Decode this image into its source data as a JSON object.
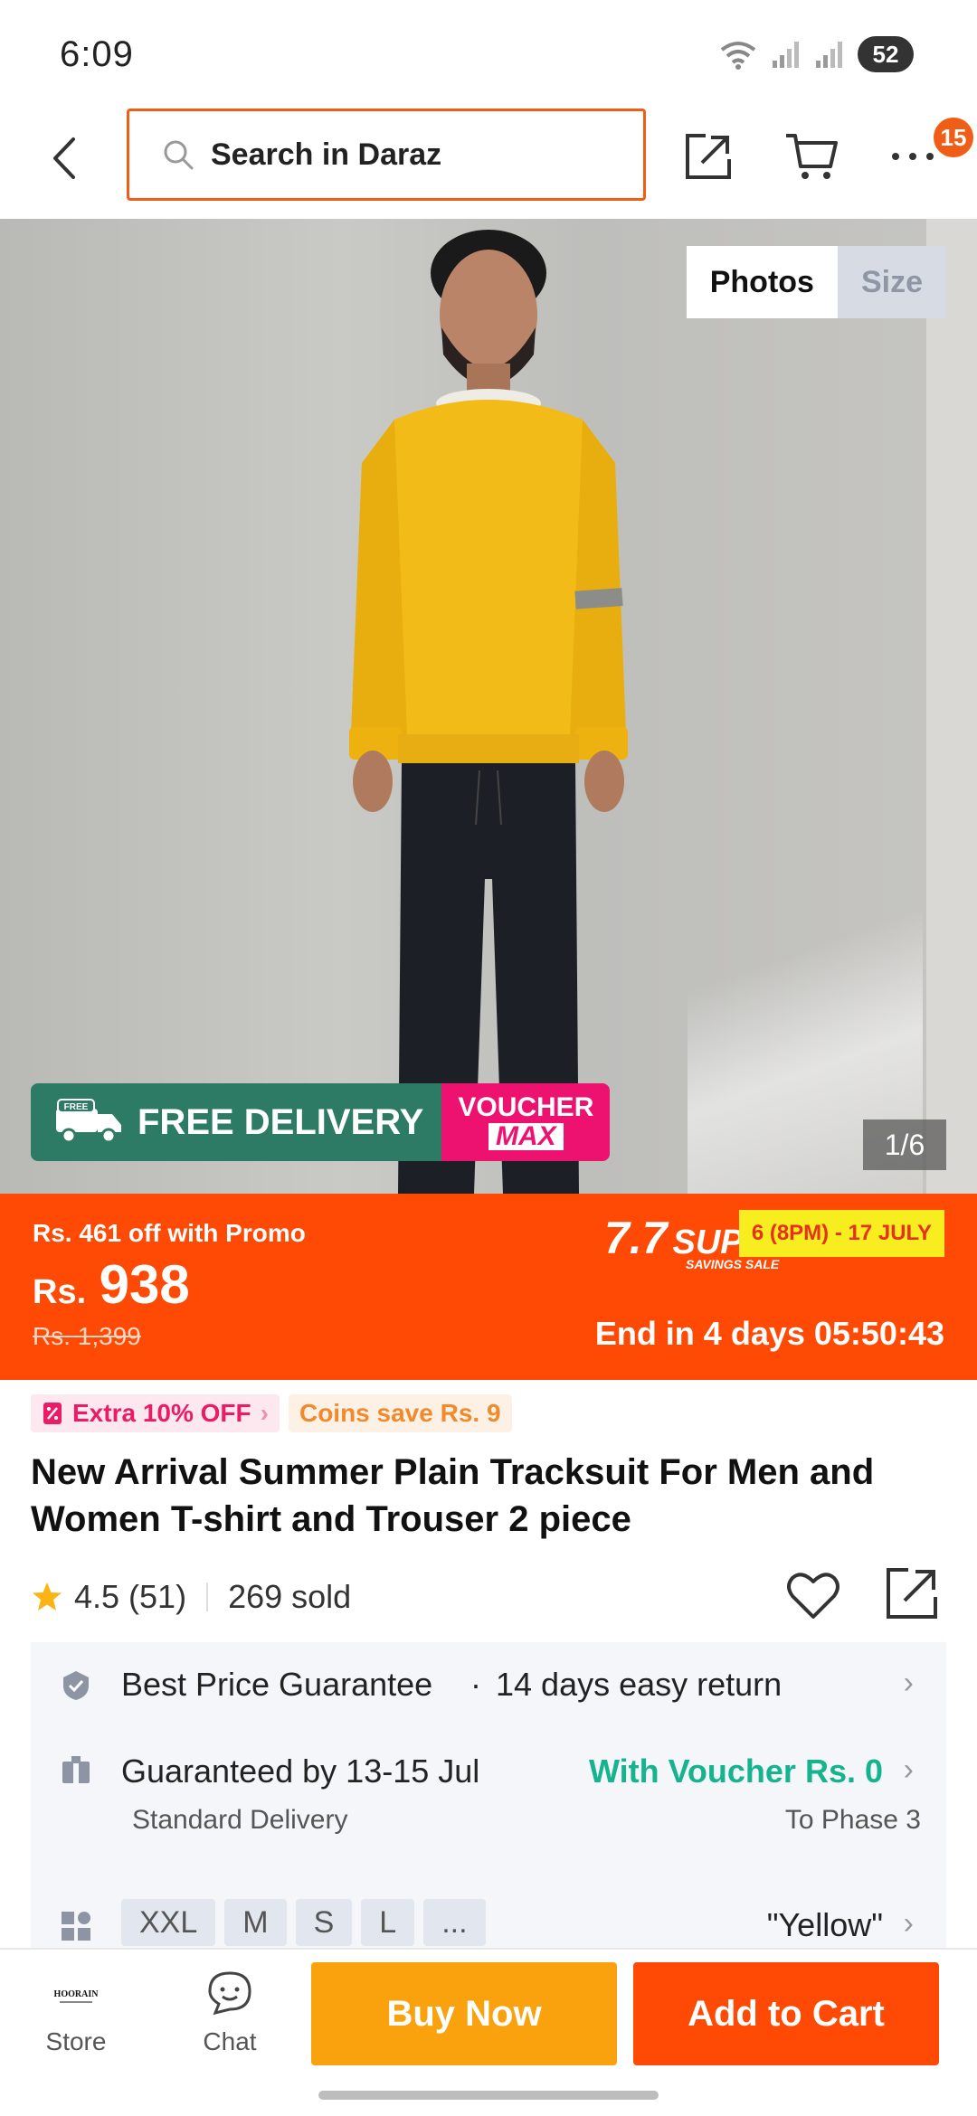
{
  "status_bar": {
    "time": "6:09",
    "battery": "52"
  },
  "header": {
    "search_placeholder": "Search in Daraz",
    "cart_badge": "15"
  },
  "gallery": {
    "tabs": [
      "Photos",
      "Size"
    ],
    "counter": "1/6",
    "free_delivery": {
      "free_tag": "FREE",
      "label": "FREE DELIVERY",
      "voucher_top": "VOUCHER",
      "voucher_bottom": "MAX"
    }
  },
  "price": {
    "promo_text": "Rs. 461 off with Promo",
    "currency": "Rs.",
    "current": "938",
    "original": "Rs. 1,399",
    "sale_logo_big": "7.7",
    "sale_logo_super": "SUPER",
    "sale_logo_sub": "SAVINGS SALE",
    "sale_dates": "6 (8PM) - 17 JULY",
    "countdown": "End in 4 days 05:50:43"
  },
  "tags": {
    "extra_off": "Extra 10% OFF",
    "coins": "Coins save Rs. 9"
  },
  "product": {
    "title": "New Arrival Summer Plain Tracksuit For Men and Women T-shirt and Trouser 2 piece",
    "rating": "4.5",
    "reviews": "(51)",
    "sold": "269 sold"
  },
  "info": {
    "guarantee": "Best Price Guarantee",
    "return": "14 days easy return",
    "delivery_date": "Guaranteed by 13-15 Jul",
    "voucher": "With Voucher Rs. 0",
    "delivery_type": "Standard Delivery",
    "phase": "To Phase 3",
    "sizes": [
      "XXL",
      "M",
      "S",
      "L",
      "..."
    ],
    "selected_color": "\"Yellow\""
  },
  "bottom_bar": {
    "store": "Store",
    "store_logo": "HOORAIN",
    "chat": "Chat",
    "buy_now": "Buy Now",
    "add_to_cart": "Add to Cart"
  },
  "colors": {
    "accent": "#fe4a04",
    "buy_now": "#f9a20d",
    "voucher_green": "#15b38e",
    "delivery_green": "#2d7b64",
    "voucher_pink": "#ee1270"
  }
}
